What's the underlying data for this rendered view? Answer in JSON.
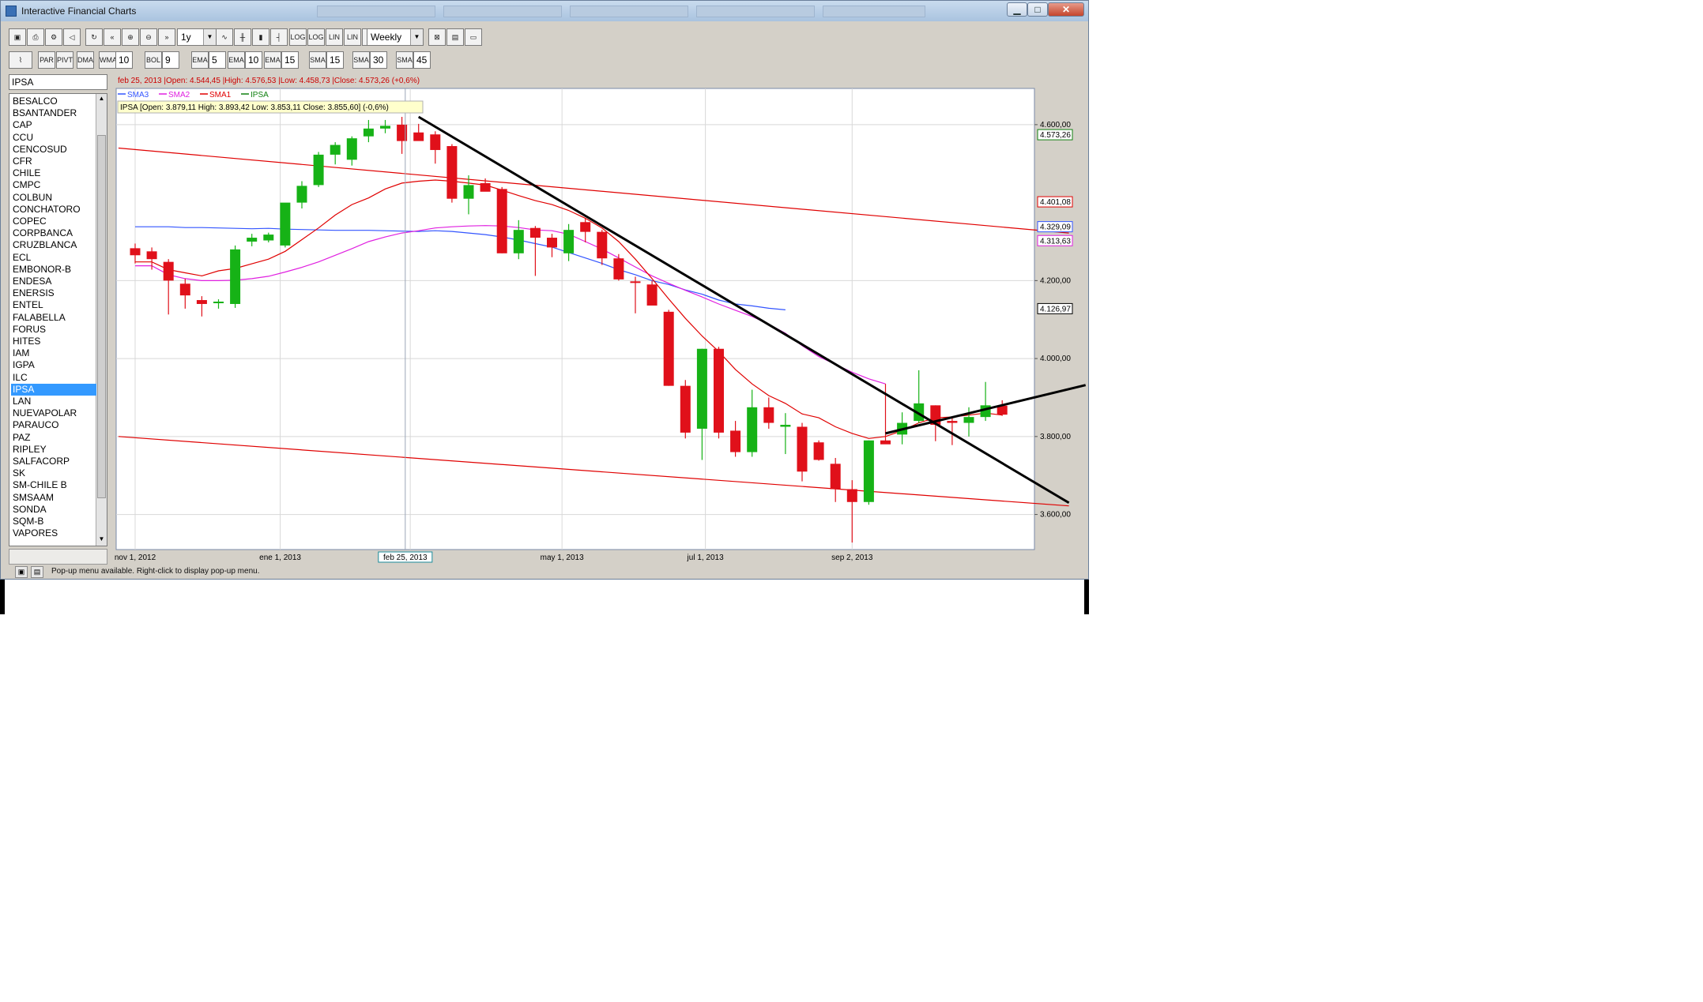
{
  "window": {
    "title": "Interactive Financial Charts",
    "controls": {
      "minimize": "▁",
      "maximize": "□",
      "close": "✕"
    }
  },
  "toolbar1": {
    "period": "1y",
    "interval": "Weekly",
    "log1_label": "LOG",
    "log2_label": "LOG",
    "lin1_label": "LIN",
    "lin2_label": "LIN",
    "percent_label": "%",
    "icons": [
      "save-icon",
      "print-icon",
      "settings-icon",
      "speaker-icon",
      "refresh-icon",
      "back-icon",
      "zoom-in-icon",
      "zoom-out-icon",
      "forward-icon",
      "line-chart-icon",
      "bar-chart-icon",
      "candlestick-icon",
      "ohlc-icon",
      "compare-icon",
      "draw-icon",
      "window-icon"
    ]
  },
  "toolbar2": {
    "par_sar": "PAR SAR",
    "pivot_pts": "PIVT PTS",
    "dma": "DMA",
    "wma": "WMA",
    "wma_value": "10",
    "bol": "BOL",
    "bol_value": "9",
    "ema1": "EMA",
    "ema1_value": "5",
    "ema2": "EMA",
    "ema2_value": "10",
    "ema3": "EMA",
    "ema3_value": "15",
    "sma1": "SMA",
    "sma1_value": "15",
    "sma2": "SMA",
    "sma2_value": "30",
    "sma3": "SMA",
    "sma3_value": "45"
  },
  "symbol_field": "IPSA",
  "symbols": [
    "BESALCO",
    "BSANTANDER",
    "CAP",
    "CCU",
    "CENCOSUD",
    "CFR",
    "CHILE",
    "CMPC",
    "COLBUN",
    "CONCHATORO",
    "COPEC",
    "CORPBANCA",
    "CRUZBLANCA",
    "ECL",
    "EMBONOR-B",
    "ENDESA",
    "ENERSIS",
    "ENTEL",
    "FALABELLA",
    "FORUS",
    "HITES",
    "IAM",
    "IGPA",
    "ILC",
    "IPSA",
    "LAN",
    "NUEVAPOLAR",
    "PARAUCO",
    "PAZ",
    "RIPLEY",
    "SALFACORP",
    "SK",
    "SM-CHILE B",
    "SMSAAM",
    "SONDA",
    "SQM-B",
    "VAPORES"
  ],
  "selected_symbol": "IPSA",
  "status": "Pop-up menu available. Right-click to display pop-up menu.",
  "chart_data": {
    "type": "candlestick",
    "header": "feb 25, 2013 |Open: 4.544,45 |High: 4.576,53 |Low: 4.458,73 |Close: 4.573,26 (+0,6%)",
    "legend": [
      "SMA3",
      "SMA2",
      "SMA1",
      "IPSA"
    ],
    "legend_colors": [
      "#3355ff",
      "#e020e0",
      "#e00000",
      "#108010"
    ],
    "cursor_info": "IPSA [Open: 3.879,11   High: 3.893,42   Low: 3.853,11   Close: 3.855,60] (-0,6%)",
    "cursor_date": "feb 25, 2013",
    "y_ticks": [
      "4.600,00",
      "4.200,00",
      "4.000,00",
      "3.800,00",
      "3.600,00"
    ],
    "y_tick_values": [
      4600,
      4200,
      4000,
      3800,
      3600
    ],
    "x_ticks": [
      "nov 1, 2012",
      "ene 1, 2013",
      "13",
      "may 1, 2013",
      "jul 1, 2013",
      "sep 2, 2013"
    ],
    "price_tags": [
      {
        "label": "4.573,26",
        "value": 4573.26,
        "color": "#108010"
      },
      {
        "label": "4.401,08",
        "value": 4401.08,
        "color": "#e00000"
      },
      {
        "label": "4.329,09",
        "value": 4329.09,
        "color": "#3355ff"
      },
      {
        "label": "4.313,63",
        "value": 4313.63,
        "color": "#e020e0"
      },
      {
        "label": "4.126,97",
        "value": 4126.97,
        "color": "#000000"
      }
    ],
    "ylim": [
      3510,
      4620
    ],
    "candles": [
      [
        4283,
        4295,
        4244,
        4265
      ],
      [
        4275,
        4285,
        4228,
        4255
      ],
      [
        4248,
        4255,
        4113,
        4200
      ],
      [
        4192,
        4205,
        4128,
        4162
      ],
      [
        4150,
        4160,
        4108,
        4140
      ],
      [
        4145,
        4152,
        4128,
        4146
      ],
      [
        4140,
        4290,
        4130,
        4280
      ],
      [
        4300,
        4320,
        4288,
        4310
      ],
      [
        4303,
        4323,
        4298,
        4318
      ],
      [
        4290,
        4395,
        4285,
        4400
      ],
      [
        4400,
        4455,
        4385,
        4443
      ],
      [
        4445,
        4530,
        4440,
        4523
      ],
      [
        4523,
        4555,
        4498,
        4548
      ],
      [
        4510,
        4570,
        4495,
        4565
      ],
      [
        4570,
        4612,
        4555,
        4590
      ],
      [
        4590,
        4612,
        4578,
        4597
      ],
      [
        4600,
        4620,
        4525,
        4558
      ],
      [
        4580,
        4602,
        4565,
        4558
      ],
      [
        4575,
        4583,
        4500,
        4535
      ],
      [
        4545,
        4550,
        4400,
        4410
      ],
      [
        4410,
        4470,
        4370,
        4445
      ],
      [
        4450,
        4462,
        4430,
        4428
      ],
      [
        4435,
        4440,
        4270,
        4270
      ],
      [
        4270,
        4355,
        4255,
        4330
      ],
      [
        4335,
        4340,
        4212,
        4310
      ],
      [
        4310,
        4320,
        4260,
        4285
      ],
      [
        4270,
        4345,
        4250,
        4330
      ],
      [
        4350,
        4360,
        4298,
        4325
      ],
      [
        4325,
        4330,
        4240,
        4257
      ],
      [
        4257,
        4268,
        4200,
        4203
      ],
      [
        4198,
        4210,
        4116,
        4196
      ],
      [
        4190,
        4200,
        4140,
        4136
      ],
      [
        4120,
        4125,
        3930,
        3930
      ],
      [
        3930,
        3945,
        3795,
        3810
      ],
      [
        3820,
        4025,
        3740,
        4025
      ],
      [
        4025,
        4030,
        3795,
        3810
      ],
      [
        3815,
        3840,
        3748,
        3760
      ],
      [
        3760,
        3920,
        3748,
        3875
      ],
      [
        3875,
        3900,
        3820,
        3835
      ],
      [
        3825,
        3860,
        3755,
        3830
      ],
      [
        3825,
        3835,
        3685,
        3710
      ],
      [
        3785,
        3790,
        3738,
        3740
      ],
      [
        3730,
        3745,
        3632,
        3665
      ],
      [
        3665,
        3688,
        3528,
        3632
      ],
      [
        3632,
        3790,
        3625,
        3790
      ],
      [
        3790,
        3935,
        3785,
        3780
      ],
      [
        3805,
        3862,
        3780,
        3835
      ],
      [
        3840,
        3970,
        3835,
        3885
      ],
      [
        3880,
        3880,
        3788,
        3830
      ],
      [
        3840,
        3850,
        3778,
        3835
      ],
      [
        3835,
        3875,
        3800,
        3850
      ],
      [
        3850,
        3940,
        3840,
        3880
      ],
      [
        3879,
        3893,
        3853,
        3856
      ]
    ],
    "sma1": [
      4248,
      4248,
      4228,
      4220,
      4212,
      4225,
      4231,
      4243,
      4255,
      4275,
      4305,
      4335,
      4368,
      4395,
      4412,
      4435,
      4450,
      4455,
      4458,
      4455,
      4450,
      4445,
      4432,
      4418,
      4405,
      4395,
      4380,
      4360,
      4335,
      4300,
      4255,
      4205,
      4153,
      4103,
      4058,
      4018,
      3972,
      3935,
      3905,
      3885,
      3858,
      3848,
      3825,
      3808,
      3795,
      3800,
      3815,
      3835,
      3848,
      3850,
      3855,
      3860,
      3855
    ],
    "sma2": [
      4238,
      4238,
      4215,
      4205,
      4200,
      4200,
      4201,
      4205,
      4211,
      4222,
      4234,
      4248,
      4265,
      4282,
      4300,
      4312,
      4322,
      4328,
      4335,
      4338,
      4340,
      4341,
      4340,
      4336,
      4330,
      4328,
      4319,
      4300,
      4281,
      4258,
      4235,
      4212,
      4193,
      4175,
      4158,
      4140,
      4124,
      4108,
      4088,
      4065,
      4033,
      4005,
      3985,
      3965,
      3948,
      3935
    ],
    "sma3": [
      4338,
      4338,
      4338,
      4336,
      4336,
      4335,
      4334,
      4333,
      4334,
      4332,
      4331,
      4330,
      4329,
      4329,
      4329,
      4328,
      4327,
      4326,
      4328,
      4326,
      4322,
      4318,
      4312,
      4304,
      4295,
      4286,
      4272,
      4258,
      4244,
      4228,
      4215,
      4200,
      4190,
      4176,
      4165,
      4150,
      4140,
      4135,
      4129,
      4125
    ],
    "trendlines": [
      {
        "from": [
          17,
          4620
        ],
        "to": [
          56,
          3630
        ],
        "color": "#000000"
      },
      {
        "from": [
          45,
          3808
        ],
        "to": [
          57,
          3932
        ],
        "color": "#000000"
      }
    ],
    "channel": [
      {
        "from": [
          -1,
          4540
        ],
        "to": [
          56,
          4322
        ],
        "color": "#e00000"
      },
      {
        "from": [
          -1,
          3800
        ],
        "to": [
          56,
          3622
        ],
        "color": "#e00000"
      }
    ]
  }
}
